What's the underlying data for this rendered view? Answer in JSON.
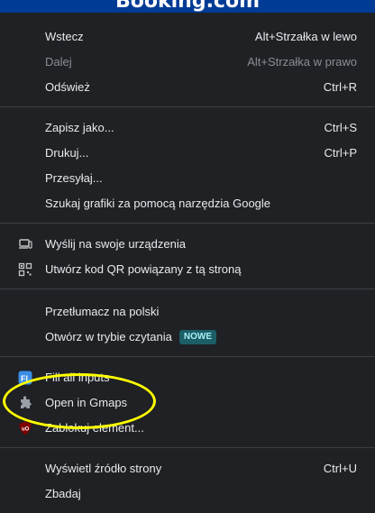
{
  "topbar": {
    "brand": "Booking.com"
  },
  "menu": {
    "back": {
      "label": "Wstecz",
      "shortcut": "Alt+Strzałka w lewo"
    },
    "forward": {
      "label": "Dalej",
      "shortcut": "Alt+Strzałka w prawo"
    },
    "reload": {
      "label": "Odśwież",
      "shortcut": "Ctrl+R"
    },
    "save_as": {
      "label": "Zapisz jako...",
      "shortcut": "Ctrl+S"
    },
    "print": {
      "label": "Drukuj...",
      "shortcut": "Ctrl+P"
    },
    "cast": {
      "label": "Przesyłaj..."
    },
    "search_image": {
      "label": "Szukaj grafiki za pomocą narzędzia Google"
    },
    "send_devices": {
      "label": "Wyślij na swoje urządzenia"
    },
    "qr_code": {
      "label": "Utwórz kod QR powiązany z tą stroną"
    },
    "translate": {
      "label": "Przetłumacz na polski"
    },
    "reading_mode": {
      "label": "Otwórz w trybie czytania",
      "badge": "NOWE"
    },
    "fill_inputs": {
      "label": "Fill all inputs"
    },
    "open_gmaps": {
      "label": "Open in Gmaps"
    },
    "block_element": {
      "label": "Zablokuj element..."
    },
    "view_source": {
      "label": "Wyświetl źródło strony",
      "shortcut": "Ctrl+U"
    },
    "inspect": {
      "label": "Zbadaj"
    }
  },
  "colors": {
    "menu_bg": "#1f2125",
    "separator": "#3c4043",
    "badge_bg": "#1b5e66",
    "highlight": "#ffff00",
    "brand_bar": "#003b95"
  }
}
